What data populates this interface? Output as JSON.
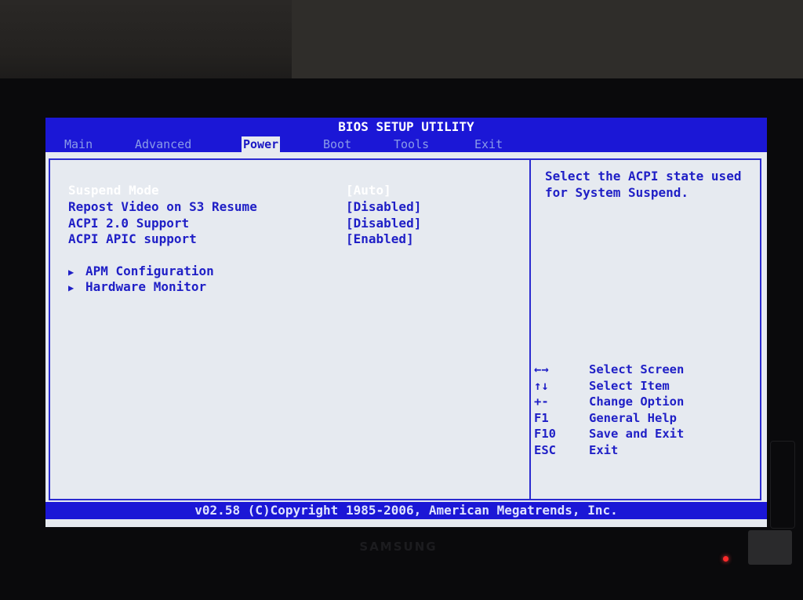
{
  "bios": {
    "title": "BIOS SETUP UTILITY",
    "menu": [
      {
        "label": "Main",
        "active": false
      },
      {
        "label": "Advanced",
        "active": false
      },
      {
        "label": "Power",
        "active": true
      },
      {
        "label": "Boot",
        "active": false
      },
      {
        "label": "Tools",
        "active": false
      },
      {
        "label": "Exit",
        "active": false
      }
    ],
    "settings": [
      {
        "label": "Suspend Mode",
        "value": "[Auto]",
        "selected": true
      },
      {
        "label": "Repost Video on S3 Resume",
        "value": "[Disabled]",
        "selected": false
      },
      {
        "label": "ACPI 2.0 Support",
        "value": "[Disabled]",
        "selected": false
      },
      {
        "label": "ACPI APIC support",
        "value": "[Enabled]",
        "selected": false
      }
    ],
    "submenus": [
      {
        "label": "APM Configuration",
        "icon": "triangle-right-icon"
      },
      {
        "label": "Hardware Monitor",
        "icon": "triangle-right-icon"
      }
    ],
    "help_text": "Select the ACPI state used for System Suspend.",
    "keys": [
      {
        "key": "←→",
        "desc": "Select Screen"
      },
      {
        "key": "↑↓",
        "desc": "Select Item"
      },
      {
        "key": "+-",
        "desc": "Change Option"
      },
      {
        "key": "F1",
        "desc": "General Help"
      },
      {
        "key": "F10",
        "desc": "Save and Exit"
      },
      {
        "key": "ESC",
        "desc": "Exit"
      }
    ],
    "footer": "v02.58 (C)Copyright 1985-2006, American Megatrends, Inc."
  },
  "monitor": {
    "brand": "SAMSUNG"
  },
  "colors": {
    "bar_blue": "#1b17d6",
    "screen_bg": "#e6eaf0",
    "text_blue": "#1f1fc6",
    "selected_text": "#ffffff",
    "power_led": "#ff2a2a"
  }
}
